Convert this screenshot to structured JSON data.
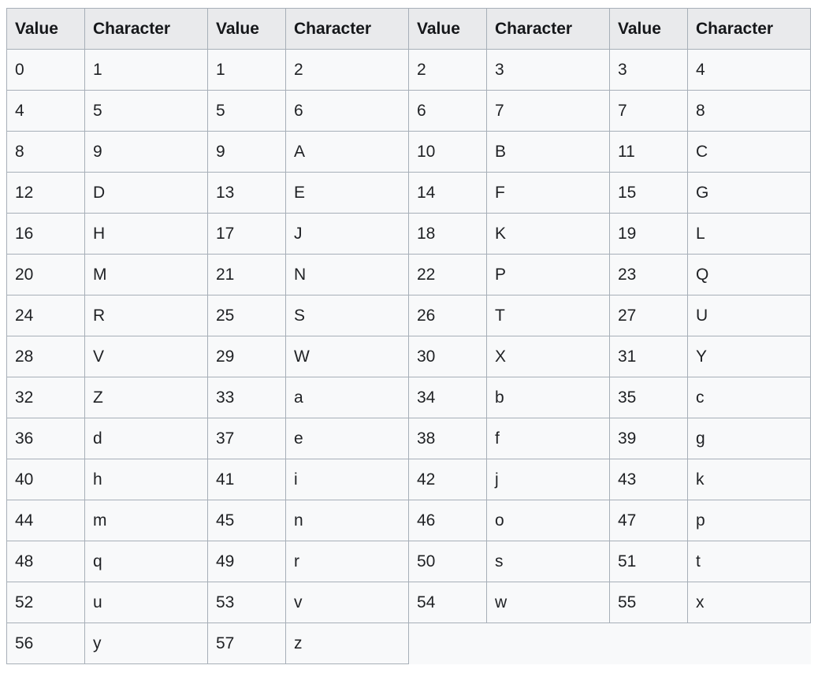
{
  "table": {
    "name": "value-character-map",
    "column_pair_count": 4,
    "headers": [
      "Value",
      "Character",
      "Value",
      "Character",
      "Value",
      "Character",
      "Value",
      "Character"
    ],
    "header_labels": {
      "value": "Value",
      "character": "Character"
    },
    "colors": {
      "page_background": "#ffffff",
      "header_background": "#e9eaec",
      "cell_background": "#f8f9fa",
      "border": "#a7afb8",
      "text": "#1f2124"
    },
    "pairs": [
      {
        "value": "0",
        "character": "1"
      },
      {
        "value": "1",
        "character": "2"
      },
      {
        "value": "2",
        "character": "3"
      },
      {
        "value": "3",
        "character": "4"
      },
      {
        "value": "4",
        "character": "5"
      },
      {
        "value": "5",
        "character": "6"
      },
      {
        "value": "6",
        "character": "7"
      },
      {
        "value": "7",
        "character": "8"
      },
      {
        "value": "8",
        "character": "9"
      },
      {
        "value": "9",
        "character": "A"
      },
      {
        "value": "10",
        "character": "B"
      },
      {
        "value": "11",
        "character": "C"
      },
      {
        "value": "12",
        "character": "D"
      },
      {
        "value": "13",
        "character": "E"
      },
      {
        "value": "14",
        "character": "F"
      },
      {
        "value": "15",
        "character": "G"
      },
      {
        "value": "16",
        "character": "H"
      },
      {
        "value": "17",
        "character": "J"
      },
      {
        "value": "18",
        "character": "K"
      },
      {
        "value": "19",
        "character": "L"
      },
      {
        "value": "20",
        "character": "M"
      },
      {
        "value": "21",
        "character": "N"
      },
      {
        "value": "22",
        "character": "P"
      },
      {
        "value": "23",
        "character": "Q"
      },
      {
        "value": "24",
        "character": "R"
      },
      {
        "value": "25",
        "character": "S"
      },
      {
        "value": "26",
        "character": "T"
      },
      {
        "value": "27",
        "character": "U"
      },
      {
        "value": "28",
        "character": "V"
      },
      {
        "value": "29",
        "character": "W"
      },
      {
        "value": "30",
        "character": "X"
      },
      {
        "value": "31",
        "character": "Y"
      },
      {
        "value": "32",
        "character": "Z"
      },
      {
        "value": "33",
        "character": "a"
      },
      {
        "value": "34",
        "character": "b"
      },
      {
        "value": "35",
        "character": "c"
      },
      {
        "value": "36",
        "character": "d"
      },
      {
        "value": "37",
        "character": "e"
      },
      {
        "value": "38",
        "character": "f"
      },
      {
        "value": "39",
        "character": "g"
      },
      {
        "value": "40",
        "character": "h"
      },
      {
        "value": "41",
        "character": "i"
      },
      {
        "value": "42",
        "character": "j"
      },
      {
        "value": "43",
        "character": "k"
      },
      {
        "value": "44",
        "character": "m"
      },
      {
        "value": "45",
        "character": "n"
      },
      {
        "value": "46",
        "character": "o"
      },
      {
        "value": "47",
        "character": "p"
      },
      {
        "value": "48",
        "character": "q"
      },
      {
        "value": "49",
        "character": "r"
      },
      {
        "value": "50",
        "character": "s"
      },
      {
        "value": "51",
        "character": "t"
      },
      {
        "value": "52",
        "character": "u"
      },
      {
        "value": "53",
        "character": "v"
      },
      {
        "value": "54",
        "character": "w"
      },
      {
        "value": "55",
        "character": "x"
      },
      {
        "value": "56",
        "character": "y"
      },
      {
        "value": "57",
        "character": "z"
      }
    ]
  }
}
